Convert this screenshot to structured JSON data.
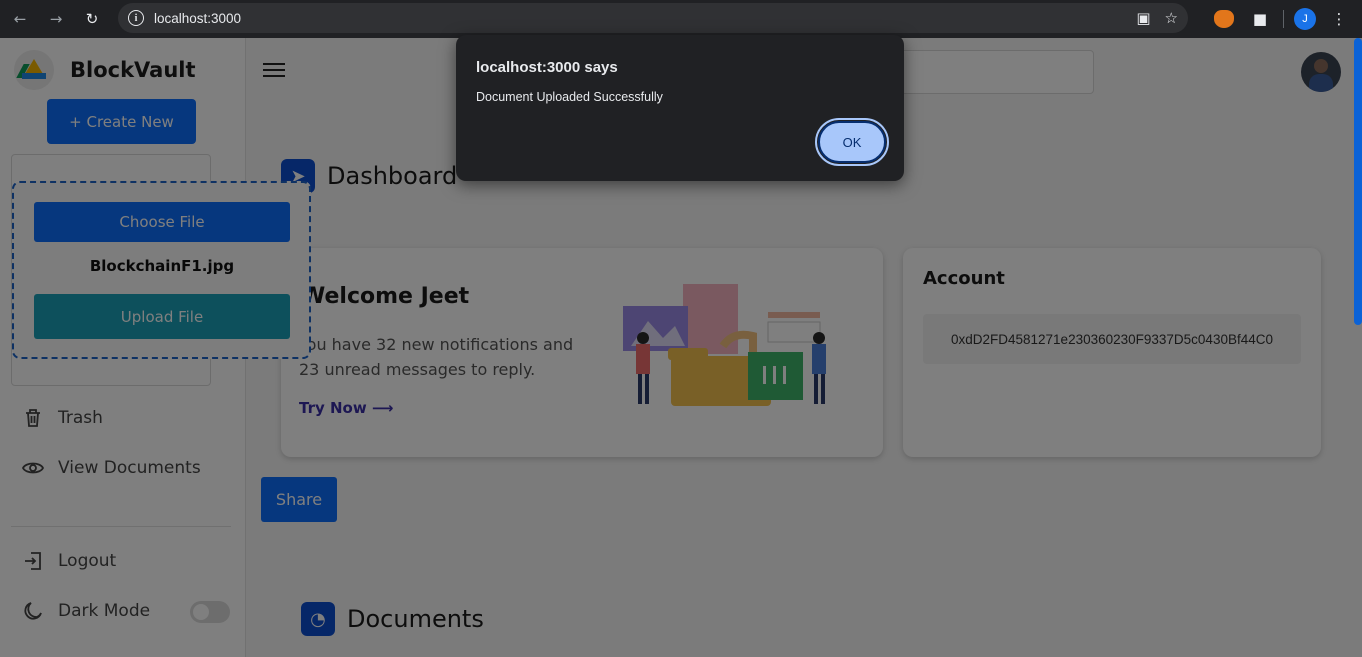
{
  "browser": {
    "url": "localhost:3000",
    "profile_initial": "J"
  },
  "brand": {
    "name": "BlockVault"
  },
  "sidebar": {
    "create_label": "+ Create New",
    "items": [
      {
        "label": "Trash",
        "icon": "trash-icon"
      },
      {
        "label": "View Documents",
        "icon": "eye-icon"
      },
      {
        "label": "Logout",
        "icon": "logout-icon"
      },
      {
        "label": "Dark Mode",
        "icon": "moon-icon"
      }
    ],
    "dark_mode_on": false
  },
  "upload": {
    "choose_label": "Choose File",
    "file_name": "BlockchainF1.jpg",
    "upload_label": "Upload File"
  },
  "dashboard": {
    "title": "Dashboard",
    "welcome": {
      "title": "Welcome Jeet",
      "text": "You have 32 new notifications and 23 unread messages to reply.",
      "link": "Try Now ⟶"
    },
    "account": {
      "title": "Account",
      "address": "0xdD2FD4581271e230360230F9337D5c0430Bf44C0"
    },
    "share_label": "Share",
    "documents_title": "Documents"
  },
  "dialog": {
    "title": "localhost:3000 says",
    "message": "Document Uploaded Successfully",
    "ok_label": "OK"
  },
  "colors": {
    "primary": "#0d6efd",
    "teal": "#1aa1b8",
    "sidebar_bg": "#ffffff",
    "dialog_bg": "#202124",
    "ok_button": "#a8c7fa"
  }
}
